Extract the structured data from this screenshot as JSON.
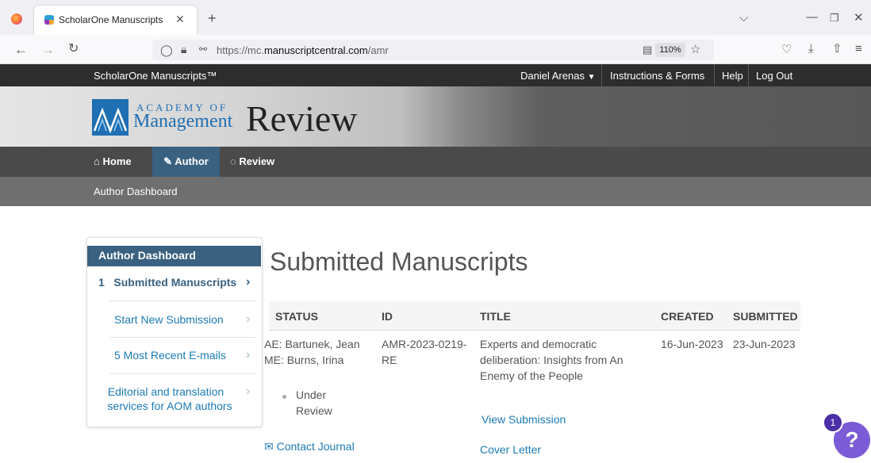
{
  "browser": {
    "tab_title": "ScholarOne Manuscripts",
    "new_tab": "+",
    "url_prefix": "https://mc.",
    "url_domain": "manuscriptcentral.com",
    "url_path": "/amr",
    "zoom": "110%"
  },
  "topbar": {
    "brand": "ScholarOne Manuscripts™",
    "user": "Daniel Arenas",
    "links": [
      "Instructions & Forms",
      "Help",
      "Log Out"
    ]
  },
  "banner": {
    "logo_line1": "ACADEMY OF",
    "logo_line2": "Management",
    "journal": "Review"
  },
  "nav": {
    "items": [
      "Home",
      "Author",
      "Review"
    ]
  },
  "breadcrumb": "Author Dashboard",
  "sidebar": {
    "title": "Author Dashboard",
    "items": [
      {
        "count": "1",
        "label": "Submitted Manuscripts"
      },
      {
        "label": "Start New Submission"
      },
      {
        "label": "5 Most Recent E-mails"
      },
      {
        "label_line1": "Editorial and translation",
        "label_line2": "services for AOM authors"
      }
    ]
  },
  "main": {
    "heading": "Submitted Manuscripts",
    "columns": [
      "STATUS",
      "ID",
      "TITLE",
      "CREATED",
      "SUBMITTED"
    ],
    "row": {
      "ae": "AE: Bartunek, Jean",
      "me": "ME: Burns, Irina",
      "status_line1": "Under",
      "status_line2": "Review",
      "id_line1": "AMR-2023-0219-",
      "id_line2": "RE",
      "title_line1": "Experts and democratic",
      "title_line2": "deliberation: Insights from An",
      "title_line3": "Enemy of the People",
      "created": "16-Jun-2023",
      "submitted": "23-Jun-2023",
      "view_submission": "View Submission",
      "cover_letter": "Cover Letter",
      "contact_journal": "Contact Journal"
    }
  },
  "help_badge": {
    "count": "1",
    "glyph": "?"
  },
  "colors": {
    "accent": "#3a6180",
    "link": "#1c7ab5",
    "help": "#7b5bd6"
  }
}
